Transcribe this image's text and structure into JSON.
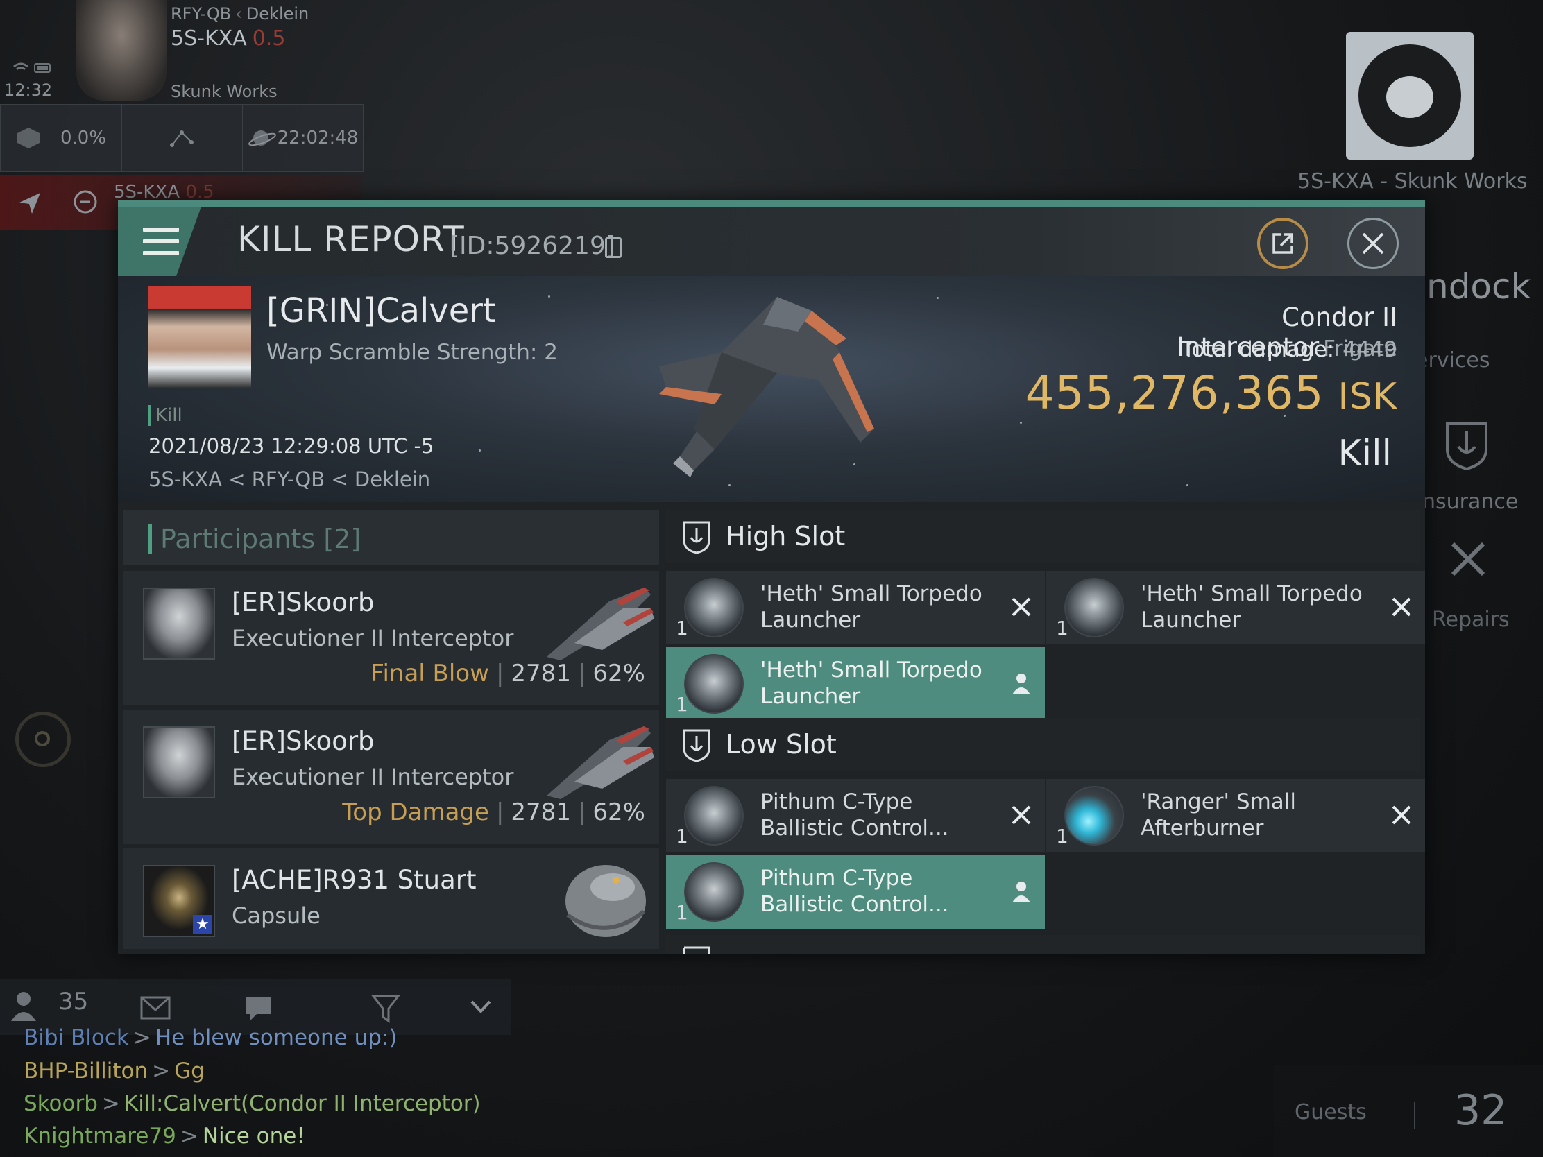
{
  "hud": {
    "route": "RFY-QB",
    "route_region": "Deklein",
    "system": "5S-KXA",
    "security": "0.5",
    "corp": "Skunk Works",
    "clock": "12:32",
    "cargo_pct": "0.0%",
    "timer": "22:02:48",
    "route_system": "5S-KXA",
    "route_security": "0.5"
  },
  "station": {
    "name": "5S-KXA - Skunk Works",
    "undock": "ndock",
    "services": "ervices",
    "insurance": "nsurance",
    "repairs": "Repairs",
    "guests_label": "Guests",
    "guests_count": "32"
  },
  "kill_report": {
    "title": "KILL REPORT",
    "id": "[ID:5926219]",
    "victim": {
      "name": "[GRIN]Calvert",
      "sub": "Warp Scramble Strength: 2",
      "kill_tag": "Kill",
      "date": "2021/08/23 12:29:08 UTC -5",
      "location": "5S-KXA < RFY-QB < Deklein"
    },
    "ship": {
      "name": "Condor II Interceptor",
      "class": "Frigate",
      "total_damage_label": "Total damage:",
      "total_damage": "4449",
      "isk_value": "455,276,365",
      "isk_unit": "ISK",
      "result": "Kill"
    },
    "participants": {
      "title": "Participants",
      "count": "[2]",
      "list": [
        {
          "name": "[ER]Skoorb",
          "ship": "Executioner II Interceptor",
          "label": "Final Blow",
          "damage": "2781",
          "percent": "62%"
        },
        {
          "name": "[ER]Skoorb",
          "ship": "Executioner II Interceptor",
          "label": "Top Damage",
          "damage": "2781",
          "percent": "62%"
        },
        {
          "name": "[ACHE]R931 Stuart",
          "ship": "Capsule"
        }
      ]
    },
    "high_slot": {
      "title": "High Slot",
      "items": [
        {
          "qty": "1",
          "name": "'Heth' Small Torpedo Launcher",
          "status": "destroyed"
        },
        {
          "qty": "1",
          "name": "'Heth' Small Torpedo Launcher",
          "status": "destroyed"
        },
        {
          "qty": "1",
          "name": "'Heth' Small Torpedo Launcher",
          "status": "dropped"
        }
      ]
    },
    "low_slot": {
      "title": "Low Slot",
      "items": [
        {
          "qty": "1",
          "name": "Pithum C-Type Ballistic Control...",
          "status": "destroyed"
        },
        {
          "qty": "1",
          "name": "'Ranger' Small Afterburner",
          "status": "destroyed"
        },
        {
          "qty": "1",
          "name": "Pithum C-Type Ballistic Control...",
          "status": "dropped"
        }
      ]
    }
  },
  "chat": {
    "member_count": "35",
    "messages": [
      {
        "sender": "Bibi Block",
        "text": "He blew someone up:)"
      },
      {
        "sender": "BHP-Billiton",
        "text": "Gg"
      },
      {
        "sender": "Skoorb",
        "text": "Kill:Calvert(Condor II Interceptor)"
      },
      {
        "sender": "Knightmare79",
        "text": "Nice one!"
      }
    ]
  },
  "colors": {
    "accent": "#4f8c80",
    "isk": "#e0b765",
    "label_gold": "#c79e54"
  }
}
